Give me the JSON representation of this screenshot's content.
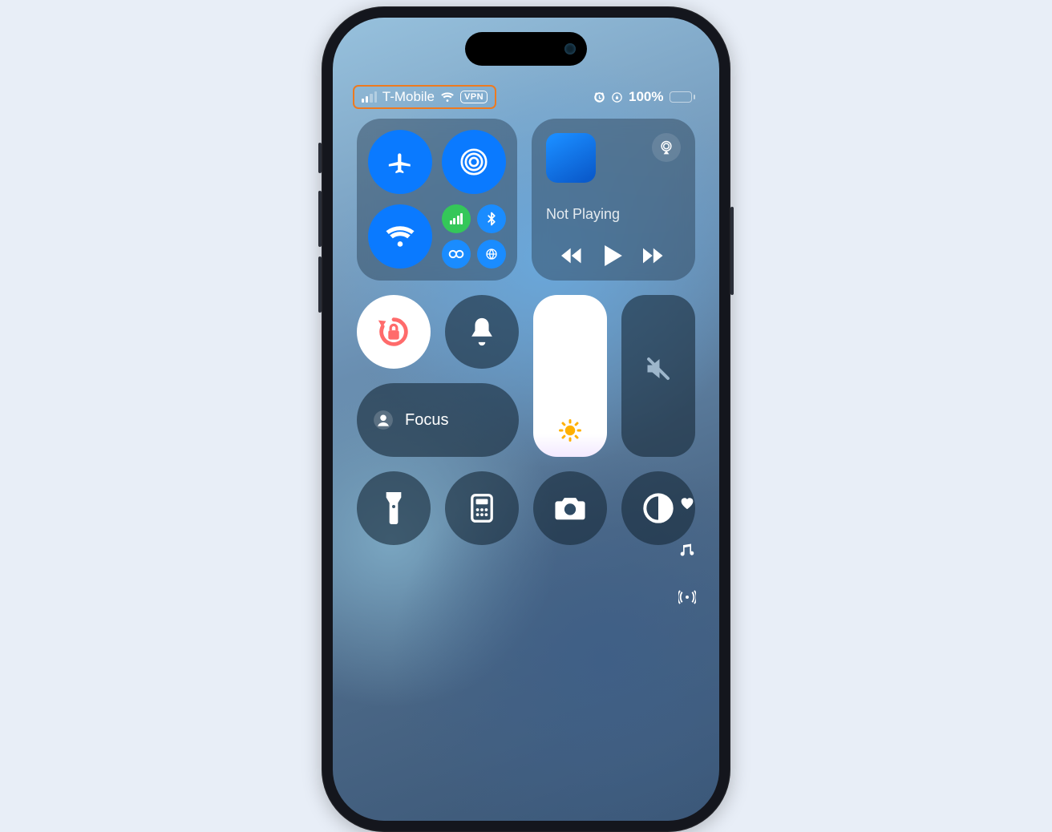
{
  "status": {
    "carrier": "T-Mobile",
    "vpn_label": "VPN",
    "battery_pct": "100%",
    "signal_bars_active": 2,
    "signal_bars_total": 4
  },
  "connectivity": {
    "airplane": false,
    "airdrop_on": true,
    "wifi_on": true,
    "cellular_on": true,
    "bluetooth_on": true
  },
  "media": {
    "title": "Not Playing"
  },
  "focus": {
    "label": "Focus"
  },
  "colors": {
    "highlight": "#ee7a1f",
    "blue": "#0a7aff",
    "green": "#34c759",
    "red_lock": "#ff5b5b"
  }
}
